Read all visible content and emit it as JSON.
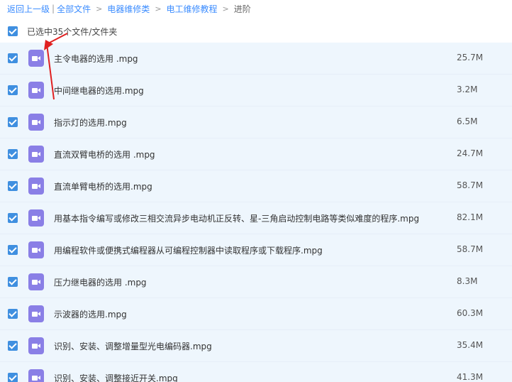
{
  "breadcrumb": {
    "back": "返回上一级",
    "all_files": "全部文件",
    "level1": "电器维修类",
    "level2": "电工维修教程",
    "current": "进阶"
  },
  "selection": {
    "summary": "已选中35个文件/文件夹",
    "checked": true
  },
  "files": [
    {
      "name": "主令电器的选用 .mpg",
      "size": "25.7M",
      "checked": true
    },
    {
      "name": "中间继电器的选用.mpg",
      "size": "3.2M",
      "checked": true
    },
    {
      "name": "指示灯的选用.mpg",
      "size": "6.5M",
      "checked": true
    },
    {
      "name": "直流双臂电桥的选用 .mpg",
      "size": "24.7M",
      "checked": true
    },
    {
      "name": "直流单臂电桥的选用.mpg",
      "size": "58.7M",
      "checked": true
    },
    {
      "name": "用基本指令编写或修改三相交流异步电动机正反转、星-三角启动控制电路等类似难度的程序.mpg",
      "size": "82.1M",
      "checked": true
    },
    {
      "name": "用编程软件或便携式编程器从可编程控制器中读取程序或下载程序.mpg",
      "size": "58.7M",
      "checked": true
    },
    {
      "name": "压力继电器的选用 .mpg",
      "size": "8.3M",
      "checked": true
    },
    {
      "name": "示波器的选用.mpg",
      "size": "60.3M",
      "checked": true
    },
    {
      "name": "识别、安装、调整增量型光电编码器.mpg",
      "size": "35.4M",
      "checked": true
    },
    {
      "name": "识别、安装、调整接近开关.mpg",
      "size": "41.3M",
      "checked": true
    }
  ],
  "colors": {
    "link": "#3b8cff",
    "checkbox": "#3f8fe0",
    "row_bg": "#eef6fd",
    "video_icon": "#8a7fe6",
    "annotation_arrow": "#e02020"
  },
  "icons": {
    "file": "video-file-icon",
    "annotation": "red-arrow-annotation"
  }
}
